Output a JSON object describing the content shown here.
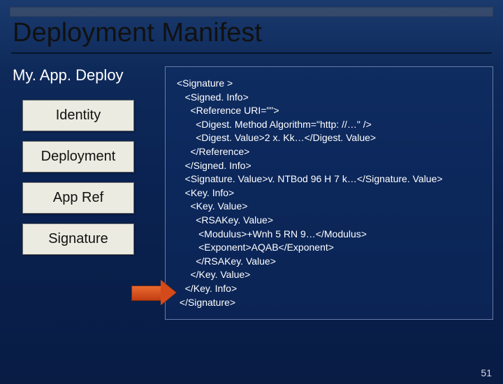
{
  "title": "Deployment Manifest",
  "subheader": "My. App. Deploy",
  "boxes": {
    "identity": "Identity",
    "deployment": "Deployment",
    "appref": "App Ref",
    "signature": "Signature"
  },
  "code": {
    "l1": "<Signature >",
    "l2": "   <Signed. Info>",
    "l3": "     <Reference URI=\"\">",
    "l4": "       <Digest. Method Algorithm=\"http: //…\" />",
    "l5": "       <Digest. Value>2 x. Kk…</Digest. Value>",
    "l6": "     </Reference>",
    "l7": "   </Signed. Info>",
    "l8": "",
    "l9": "   <Signature. Value>v. NTBod 96 H 7 k…</Signature. Value>",
    "l10": "",
    "l11": "   <Key. Info>",
    "l12": "     <Key. Value>",
    "l13": "       <RSAKey. Value>",
    "l14": "        <Modulus>+Wnh 5 RN 9…</Modulus>",
    "l15": "        <Exponent>AQAB</Exponent>",
    "l16": "       </RSAKey. Value>",
    "l17": "     </Key. Value>",
    "l18": "   </Key. Info>",
    "l19": " </Signature>"
  },
  "slide_number": "51"
}
